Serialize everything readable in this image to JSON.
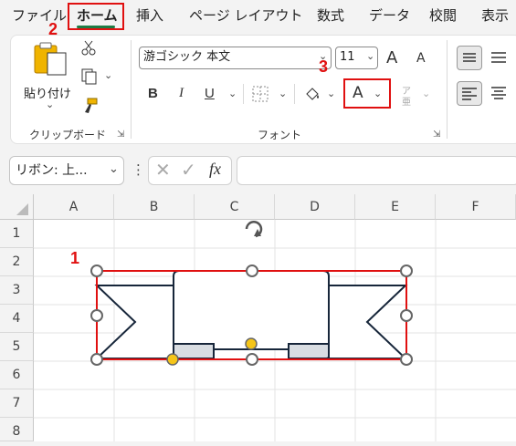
{
  "menu": {
    "items": [
      "ファイル",
      "ホーム",
      "挿入",
      "ページ レイアウト",
      "数式",
      "データ",
      "校閲",
      "表示"
    ]
  },
  "ribbon": {
    "clipboard": {
      "paste_label": "貼り付け",
      "group_label": "クリップボード"
    },
    "font": {
      "font_name": "游ゴシック 本文",
      "font_size": "11",
      "bold": "B",
      "italic": "I",
      "underline": "U",
      "font_color_letter": "A",
      "phonetic_letter": "ア",
      "phonetic_sub": "亜",
      "grow_letter": "A",
      "shrink_letter": "A",
      "group_label": "フォント"
    }
  },
  "formula_bar": {
    "name_box": "リボン: 上...",
    "fx": "fx",
    "formula": ""
  },
  "grid": {
    "columns": [
      "A",
      "B",
      "C",
      "D",
      "E",
      "F"
    ],
    "rows": [
      "1",
      "2",
      "3",
      "4",
      "5",
      "6",
      "7",
      "8"
    ]
  },
  "annotations": {
    "step1": "1",
    "step2": "2",
    "step3": "3",
    "color": "#e01010"
  },
  "colors": {
    "accent_green": "#1e7b45",
    "shape_outline": "#17263a",
    "shape_fill_light": "#d9dde2",
    "handle_yellow": "#f5c518"
  }
}
